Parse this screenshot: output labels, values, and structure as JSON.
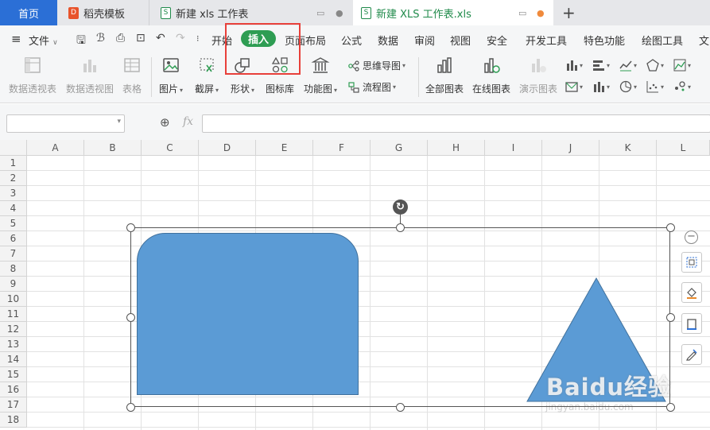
{
  "tabs": [
    {
      "label": "首页",
      "active": false
    },
    {
      "label": "稻壳模板",
      "icon": "docer-icon"
    },
    {
      "label": "新建 xls 工作表",
      "icon": "xls-file-icon"
    },
    {
      "label": "新建 XLS 工作表.xls",
      "icon": "xls-file-icon",
      "active": true
    }
  ],
  "menubar": {
    "file_label": "文件",
    "menu_items": [
      "开始",
      "插入",
      "页面布局",
      "公式",
      "数据",
      "审阅",
      "视图",
      "安全",
      "开发工具",
      "特色功能",
      "绘图工具",
      "文"
    ],
    "active_item": "插入"
  },
  "ribbon": {
    "buttons": [
      {
        "label": "数据透视表",
        "disabled": true
      },
      {
        "label": "数据透视图",
        "disabled": true
      },
      {
        "label": "表格",
        "disabled": true
      },
      {
        "label": "图片",
        "dropdown": true
      },
      {
        "label": "截屏",
        "dropdown": true
      },
      {
        "label": "形状",
        "dropdown": true
      },
      {
        "label": "图标库"
      },
      {
        "label": "功能图",
        "dropdown": true
      },
      {
        "label": "全部图表"
      },
      {
        "label": "在线图表"
      },
      {
        "label": "演示图表",
        "disabled": true
      }
    ],
    "small_buttons": [
      {
        "label": "思维导图",
        "dropdown": true
      },
      {
        "label": "流程图",
        "dropdown": true
      }
    ]
  },
  "formula_bar": {
    "fx_label": "fx",
    "name_box_value": "",
    "formula_value": ""
  },
  "grid": {
    "columns": [
      "A",
      "B",
      "C",
      "D",
      "E",
      "F",
      "G",
      "H",
      "I",
      "J",
      "K",
      "L"
    ],
    "rows": [
      "1",
      "2",
      "3",
      "4",
      "5",
      "6",
      "7",
      "8",
      "9",
      "10",
      "11",
      "12",
      "13",
      "14",
      "15",
      "16",
      "17",
      "18"
    ]
  },
  "shapes": {
    "fill_color": "#5b9bd5",
    "outline_color": "#41719c"
  },
  "colors": {
    "accent_green": "#2e9d53",
    "home_tab_blue": "#2b6fd6",
    "highlight_red": "#e8403a"
  },
  "watermark": {
    "text": "Baidu经验",
    "sub": "jingyan.baidu.com"
  }
}
